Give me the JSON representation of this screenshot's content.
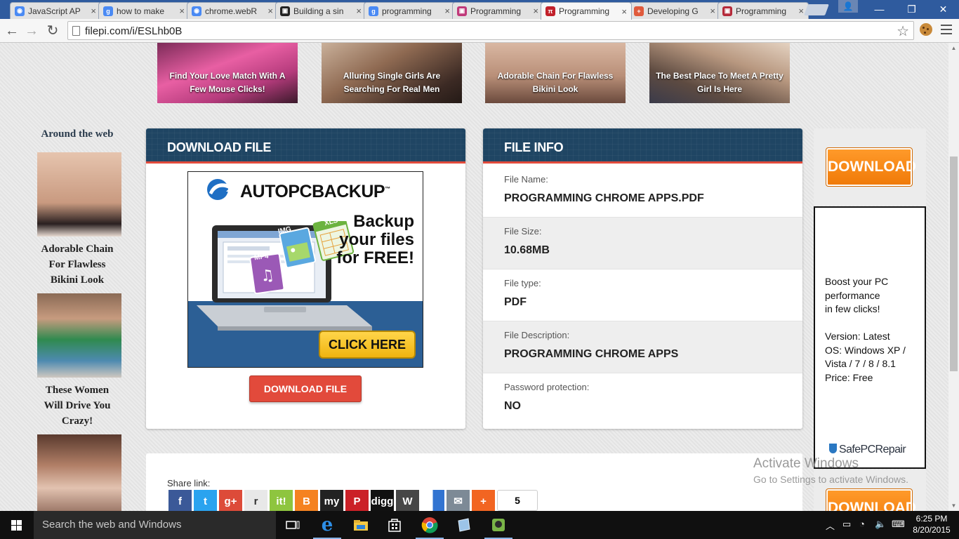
{
  "browser": {
    "tabs": [
      {
        "label": "JavaScript AP",
        "favicon": "chrome-icon",
        "color": "#4a8af4",
        "active": false
      },
      {
        "label": "how to make",
        "favicon": "google-icon",
        "color": "#4a8af4",
        "active": false
      },
      {
        "label": "chrome.webR",
        "favicon": "chrome-icon",
        "color": "#4a8af4",
        "active": false
      },
      {
        "label": "Building a sin",
        "favicon": "site-icon",
        "color": "#222222",
        "active": false
      },
      {
        "label": "programming",
        "favicon": "google-icon",
        "color": "#4a8af4",
        "active": false
      },
      {
        "label": "Programming",
        "favicon": "site-icon",
        "color": "#c0397a",
        "active": false
      },
      {
        "label": "Programming",
        "favicon": "pi-icon",
        "color": "#c2212b",
        "active": true
      },
      {
        "label": "Developing G",
        "favicon": "plus-icon",
        "color": "#e05a3c",
        "active": false
      },
      {
        "label": "Programming",
        "favicon": "site-icon",
        "color": "#b52a3a",
        "active": false
      }
    ],
    "url": "filepi.com/i/ESLhb0B"
  },
  "promos": [
    {
      "text": "Find Your Love Match With A Few Mouse Clicks!"
    },
    {
      "text": "Alluring Single Girls Are Searching For Real Men"
    },
    {
      "text": "Adorable Chain For Flawless Bikini Look"
    },
    {
      "text": "The Best Place To Meet A Pretty Girl Is Here"
    }
  ],
  "around_web": {
    "title": "Around the web",
    "items": [
      {
        "caption": "Adorable Chain For Flawless Bikini Look"
      },
      {
        "caption": "These Women Will Drive You Crazy!"
      },
      {
        "caption": ""
      }
    ]
  },
  "download_panel": {
    "title": "DOWNLOAD FILE",
    "ad": {
      "brand": "AUTOPCBACKUP",
      "tm": "™",
      "tagline": "Backup your files for FREE!",
      "cta": "CLICK HERE",
      "badges": [
        "IMG",
        "XLS",
        "MP4"
      ]
    },
    "button": "DOWNLOAD FILE"
  },
  "file_info": {
    "title": "FILE INFO",
    "rows": [
      {
        "key": "File Name:",
        "value": "PROGRAMMING CHROME APPS.PDF"
      },
      {
        "key": "File Size:",
        "value": "10.68MB"
      },
      {
        "key": "File type:",
        "value": "PDF"
      },
      {
        "key": "File Description:",
        "value": "PROGRAMMING CHROME APPS"
      },
      {
        "key": "Password protection:",
        "value": "NO"
      }
    ]
  },
  "side": {
    "download_label": "DOWNLOAD",
    "ad_lines": [
      "Boost your PC",
      "performance",
      "in few clicks!",
      "",
      "Version: Latest",
      "OS: Windows XP /",
      "Vista / 7 / 8 / 8.1",
      "Price: Free"
    ],
    "ad_brand": "SafePCRepair"
  },
  "share": {
    "label": "Share link:",
    "icons": [
      {
        "name": "facebook-icon",
        "glyph": "f",
        "color": "#3b5998"
      },
      {
        "name": "twitter-icon",
        "glyph": "t",
        "color": "#2aa3ef"
      },
      {
        "name": "google-plus-icon",
        "glyph": "g+",
        "color": "#dd4b39"
      },
      {
        "name": "reddit-icon",
        "glyph": "r",
        "color": "#e8e8e8"
      },
      {
        "name": "scoopit-icon",
        "glyph": "it!",
        "color": "#8ec53f"
      },
      {
        "name": "blogger-icon",
        "glyph": "B",
        "color": "#f58220"
      },
      {
        "name": "myspace-icon",
        "glyph": "my",
        "color": "#222222"
      },
      {
        "name": "pinterest-icon",
        "glyph": "P",
        "color": "#cb2027"
      },
      {
        "name": "digg-icon",
        "glyph": "digg",
        "color": "#111111"
      },
      {
        "name": "wordpress-icon",
        "glyph": "W",
        "color": "#464646"
      },
      {
        "name": "delicious-icon",
        "glyph": "",
        "color": "#3274d1"
      },
      {
        "name": "email-icon",
        "glyph": "✉",
        "color": "#7d8a96"
      },
      {
        "name": "more-share-icon",
        "glyph": "+",
        "color": "#f26522"
      }
    ],
    "count": "5"
  },
  "activation": {
    "line1": "Activate Windows",
    "line2": "Go to Settings to activate Windows."
  },
  "taskbar": {
    "search_placeholder": "Search the web and Windows",
    "time": "6:25 PM",
    "date": "8/20/2015"
  }
}
